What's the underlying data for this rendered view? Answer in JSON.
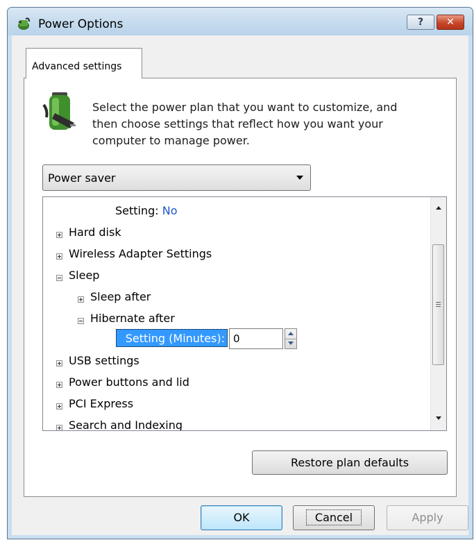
{
  "window": {
    "title": "Power Options",
    "help_label": "?",
    "close_label": "✕"
  },
  "tab": {
    "label": "Advanced settings"
  },
  "intro_text": "Select the power plan that you want to customize, and then choose settings that reflect how you want your computer to manage power.",
  "plan_select": {
    "value": "Power saver"
  },
  "tree": {
    "setting_prefix": "Setting:",
    "setting_value": "No",
    "items": [
      {
        "label": "Hard disk"
      },
      {
        "label": "Wireless Adapter Settings"
      },
      {
        "label": "Sleep"
      },
      {
        "label": "Sleep after"
      },
      {
        "label": "Hibernate after"
      },
      {
        "label": "USB settings"
      },
      {
        "label": "Power buttons and lid"
      },
      {
        "label": "PCI Express"
      },
      {
        "label": "Search and Indexing"
      }
    ],
    "hibernate_setting": {
      "label": "Setting (Minutes):",
      "value": "0"
    }
  },
  "buttons": {
    "restore": "Restore plan defaults",
    "ok": "OK",
    "cancel": "Cancel",
    "apply": "Apply"
  },
  "colors": {
    "selection": "#3399ff",
    "setting_value": "#1f55c8",
    "titlebar": "#c7dcee",
    "close_button": "#c8462a"
  }
}
